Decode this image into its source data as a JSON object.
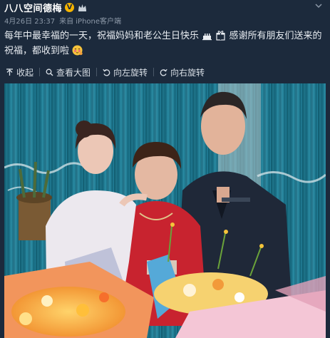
{
  "post": {
    "username": "八八空间德梅",
    "vip_badge": "V",
    "date": "4月26日 23:37",
    "source": "来自 iPhone客户端",
    "text": "每年中最幸福的一天，祝福妈妈和老公生日快乐",
    "text2": "感谢所有朋友们送来的祝福，都收到啦"
  },
  "toolbar": {
    "collapse_label": "收起",
    "view_large_label": "查看大图",
    "rotate_left_label": "向左旋转",
    "rotate_right_label": "向右旋转"
  },
  "colors": {
    "background": "#1c2a3c",
    "vip_gold": "#f5b400",
    "curtain_teal": "#1d7a90"
  },
  "icons": [
    "vip-badge-icon",
    "crown-icon",
    "more-icon",
    "cake-icon",
    "gift-icon",
    "shy-emoji-icon",
    "collapse-icon",
    "magnifier-icon",
    "rotate-left-icon",
    "rotate-right-icon"
  ]
}
